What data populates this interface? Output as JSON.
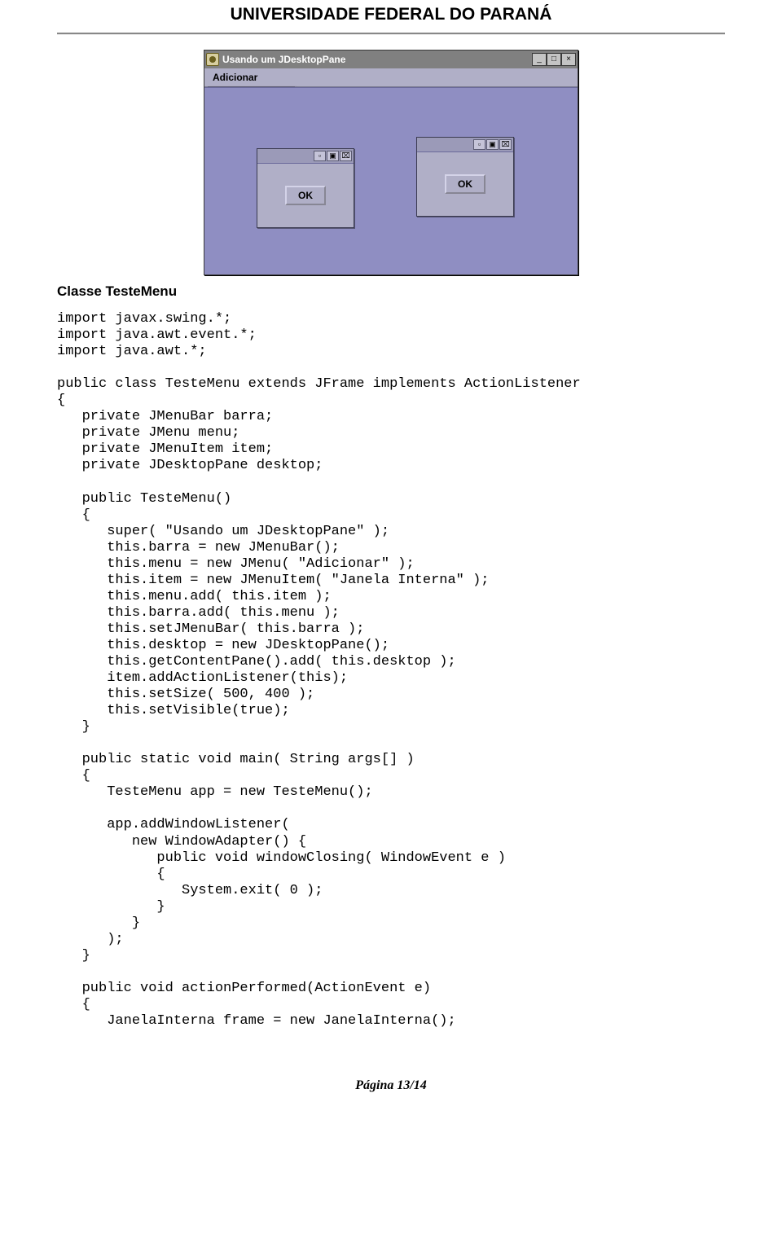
{
  "header": {
    "title": "UNIVERSIDADE FEDERAL DO PARANÁ"
  },
  "window": {
    "title": "Usando um JDesktopPane",
    "title_buttons": {
      "min": "_",
      "max": "□",
      "close": "×"
    },
    "menu": {
      "label": "Adicionar"
    },
    "dropdown": {
      "item": "Janela Interna"
    },
    "internal_frame": {
      "buttons": {
        "iconify": "▫",
        "maximize": "▣",
        "close": "⌧"
      },
      "ok": "OK"
    }
  },
  "section": {
    "label": "Classe TesteMenu"
  },
  "code": "import javax.swing.*;\nimport java.awt.event.*;\nimport java.awt.*;\n\npublic class TesteMenu extends JFrame implements ActionListener\n{\n   private JMenuBar barra;\n   private JMenu menu;\n   private JMenuItem item;\n   private JDesktopPane desktop;\n\n   public TesteMenu()\n   {\n      super( \"Usando um JDesktopPane\" );\n      this.barra = new JMenuBar();\n      this.menu = new JMenu( \"Adicionar\" );\n      this.item = new JMenuItem( \"Janela Interna\" );\n      this.menu.add( this.item );\n      this.barra.add( this.menu );\n      this.setJMenuBar( this.barra );\n      this.desktop = new JDesktopPane();\n      this.getContentPane().add( this.desktop );\n      item.addActionListener(this);\n      this.setSize( 500, 400 );\n      this.setVisible(true);\n   }\n\n   public static void main( String args[] )\n   {\n      TesteMenu app = new TesteMenu();\n\n      app.addWindowListener(\n         new WindowAdapter() {\n            public void windowClosing( WindowEvent e )\n            {\n               System.exit( 0 );\n            }\n         }\n      );\n   }\n\n   public void actionPerformed(ActionEvent e)\n   {\n      JanelaInterna frame = new JanelaInterna();",
  "footer": {
    "page": "Página 13/14"
  }
}
